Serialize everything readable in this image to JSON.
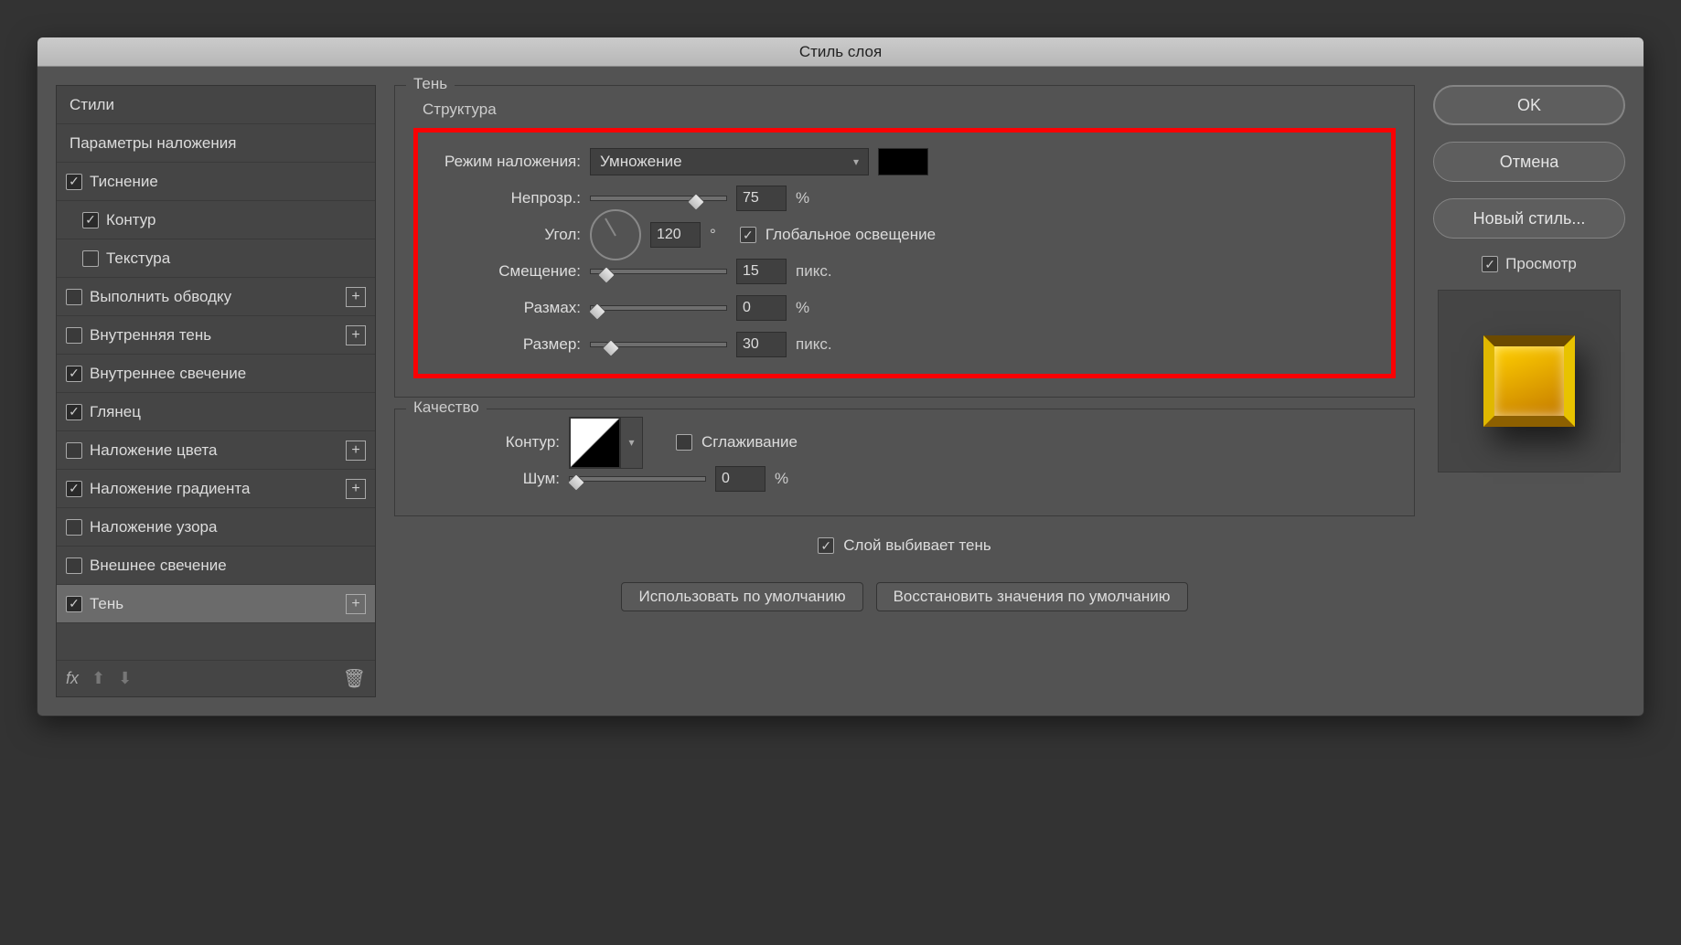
{
  "title": "Стиль слоя",
  "sidebar": {
    "items": [
      {
        "label": "Стили",
        "checkbox": false,
        "checked": false,
        "plus": false,
        "indent": 0
      },
      {
        "label": "Параметры наложения",
        "checkbox": false,
        "checked": false,
        "plus": false,
        "indent": 0
      },
      {
        "label": "Тиснение",
        "checkbox": true,
        "checked": true,
        "plus": false,
        "indent": 0
      },
      {
        "label": "Контур",
        "checkbox": true,
        "checked": true,
        "plus": false,
        "indent": 1
      },
      {
        "label": "Текстура",
        "checkbox": true,
        "checked": false,
        "plus": false,
        "indent": 1
      },
      {
        "label": "Выполнить обводку",
        "checkbox": true,
        "checked": false,
        "plus": true,
        "indent": 0
      },
      {
        "label": "Внутренняя тень",
        "checkbox": true,
        "checked": false,
        "plus": true,
        "indent": 0
      },
      {
        "label": "Внутреннее свечение",
        "checkbox": true,
        "checked": true,
        "plus": false,
        "indent": 0
      },
      {
        "label": "Глянец",
        "checkbox": true,
        "checked": true,
        "plus": false,
        "indent": 0
      },
      {
        "label": "Наложение цвета",
        "checkbox": true,
        "checked": false,
        "plus": true,
        "indent": 0
      },
      {
        "label": "Наложение градиента",
        "checkbox": true,
        "checked": true,
        "plus": true,
        "indent": 0
      },
      {
        "label": "Наложение узора",
        "checkbox": true,
        "checked": false,
        "plus": false,
        "indent": 0
      },
      {
        "label": "Внешнее свечение",
        "checkbox": true,
        "checked": false,
        "plus": false,
        "indent": 0
      },
      {
        "label": "Тень",
        "checkbox": true,
        "checked": true,
        "plus": true,
        "indent": 0,
        "selected": true
      }
    ],
    "footer": {
      "fx": "fx"
    }
  },
  "main": {
    "group1_title": "Тень",
    "structure_title": "Структура",
    "blend_label": "Режим наложения:",
    "blend_value": "Умножение",
    "opacity_label": "Непрозр.:",
    "opacity_value": "75",
    "percent": "%",
    "angle_label": "Угол:",
    "angle_value": "120",
    "degree": "°",
    "global_light_label": "Глобальное освещение",
    "global_light_checked": true,
    "distance_label": "Смещение:",
    "distance_value": "15",
    "px": "пикс.",
    "spread_label": "Размах:",
    "spread_value": "0",
    "size_label": "Размер:",
    "size_value": "30",
    "group2_title": "Качество",
    "contour_label": "Контур:",
    "aa_label": "Сглаживание",
    "aa_checked": false,
    "noise_label": "Шум:",
    "noise_value": "0",
    "knockout_label": "Слой выбивает тень",
    "knockout_checked": true,
    "btn_default": "Использовать по умолчанию",
    "btn_reset": "Восстановить значения по умолчанию"
  },
  "right": {
    "ok": "OK",
    "cancel": "Отмена",
    "newstyle": "Новый стиль...",
    "preview_label": "Просмотр",
    "preview_checked": true
  }
}
